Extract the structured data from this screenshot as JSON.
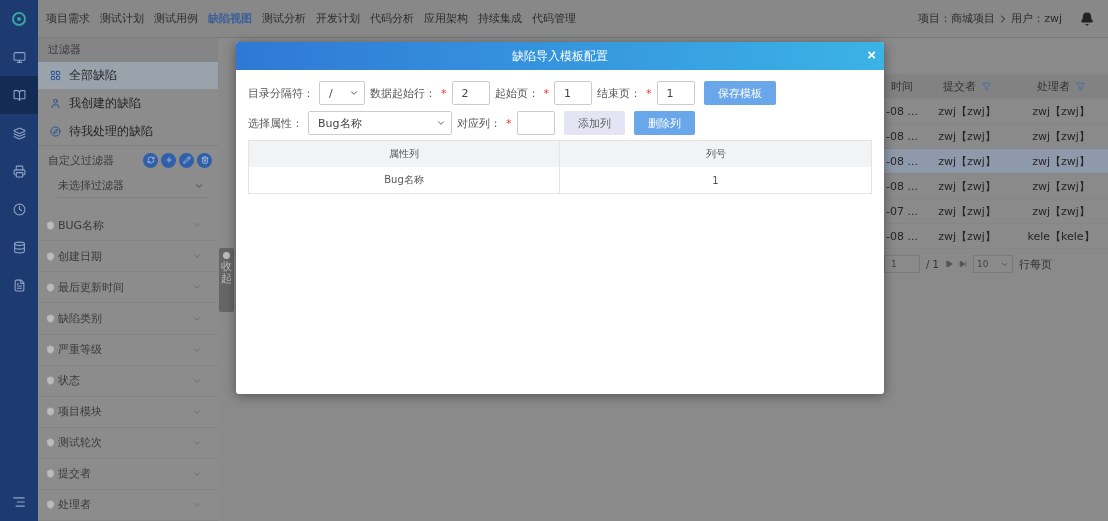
{
  "top_nav": {
    "items": [
      {
        "label": "项目需求",
        "selected": false
      },
      {
        "label": "测试计划",
        "selected": false
      },
      {
        "label": "测试用例",
        "selected": false
      },
      {
        "label": "缺陷视图",
        "selected": true
      },
      {
        "label": "测试分析",
        "selected": false
      },
      {
        "label": "开发计划",
        "selected": false
      },
      {
        "label": "代码分析",
        "selected": false
      },
      {
        "label": "应用架构",
        "selected": false
      },
      {
        "label": "持续集成",
        "selected": false
      },
      {
        "label": "代码管理",
        "selected": false
      }
    ],
    "project": "项目：商城项目",
    "user": "用户：zwj"
  },
  "rail": {
    "items": [
      {
        "selected": false
      },
      {
        "selected": true
      },
      {
        "selected": false
      },
      {
        "selected": false
      },
      {
        "selected": false
      },
      {
        "selected": false
      },
      {
        "selected": false
      }
    ]
  },
  "sidebar": {
    "title": "过滤器",
    "quick_filters": [
      {
        "label": "全部缺陷",
        "selected": true
      },
      {
        "label": "我创建的缺陷",
        "selected": false
      },
      {
        "label": "待我处理的缺陷",
        "selected": false
      }
    ],
    "custom_label": "自定义过滤器",
    "custom_select": "未选择过滤器",
    "fields": [
      {
        "label": "BUG名称",
        "expanded": false
      },
      {
        "label": "创建日期",
        "expanded": false
      },
      {
        "label": "最后更新时间",
        "expanded": false
      },
      {
        "label": "缺陷类别",
        "expanded": false
      },
      {
        "label": "严重等级",
        "expanded": false
      },
      {
        "label": "状态",
        "expanded": false
      },
      {
        "label": "项目模块",
        "expanded": false
      },
      {
        "label": "测试轮次",
        "expanded": false
      },
      {
        "label": "提交者",
        "expanded": false
      },
      {
        "label": "处理者",
        "expanded": false
      }
    ]
  },
  "collapse_tab": {
    "label": "收起"
  },
  "table": {
    "columns": [
      {
        "label": "时间",
        "filter": false
      },
      {
        "label": "提交者",
        "filter": true
      },
      {
        "label": "处理者",
        "filter": true
      }
    ],
    "rows": [
      {
        "cells": [
          "-08 ...",
          "zwj【zwj】",
          "zwj【zwj】"
        ],
        "selected": false
      },
      {
        "cells": [
          "-08 ...",
          "zwj【zwj】",
          "zwj【zwj】"
        ],
        "selected": false
      },
      {
        "cells": [
          "-08 ...",
          "zwj【zwj】",
          "zwj【zwj】"
        ],
        "selected": true
      },
      {
        "cells": [
          "-08 ...",
          "zwj【zwj】",
          "zwj【zwj】"
        ],
        "selected": false
      },
      {
        "cells": [
          "-07 ...",
          "zwj【zwj】",
          "zwj【zwj】"
        ],
        "selected": false
      },
      {
        "cells": [
          "-08 ...",
          "zwj【zwj】",
          "kele【kele】"
        ],
        "selected": false
      }
    ],
    "pagination": {
      "page": "1",
      "total": "/ 1",
      "page_size": "10",
      "suffix": "行每页"
    }
  },
  "dialog": {
    "title": "缺陷导入模板配置",
    "close": "×",
    "row1": [
      {
        "kind": "select",
        "label": "目录分隔符：",
        "value": "/"
      },
      {
        "kind": "input",
        "label": "数据起始行：",
        "required_mark": "*",
        "value": "2"
      },
      {
        "kind": "input",
        "label": "起始页：",
        "required_mark": "*",
        "value": "1"
      },
      {
        "kind": "input",
        "label": "结束页：",
        "required_mark": "*",
        "value": "1"
      },
      {
        "kind": "button",
        "label": "保存模板"
      }
    ],
    "row2": [
      {
        "kind": "select",
        "label": "选择属性：",
        "value": "Bug名称"
      },
      {
        "kind": "input",
        "label": "对应列：",
        "required_mark": "*"
      },
      {
        "kind": "softbutton",
        "label": "添加列"
      },
      {
        "kind": "button",
        "label": "删除列"
      }
    ],
    "table": {
      "columns": [
        "属性列",
        "列号"
      ],
      "rows": [
        [
          "Bug名称",
          "1"
        ]
      ]
    }
  }
}
